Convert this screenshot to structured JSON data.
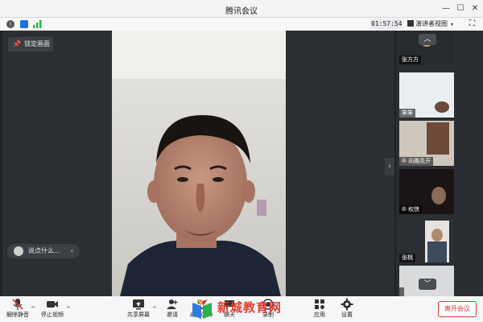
{
  "app": {
    "title": "腾讯会议"
  },
  "infobar": {
    "timer": "01:57:54",
    "view_label": "演讲者视图"
  },
  "stage": {
    "lock_label": "锁定画面",
    "chat_placeholder": "说点什么..."
  },
  "participants": [
    {
      "name": "张方方"
    },
    {
      "name": "笨笨"
    },
    {
      "name": "向晚花开"
    },
    {
      "name": "权侠"
    },
    {
      "name": "张桃"
    },
    {
      "name": ""
    }
  ],
  "toolbar": {
    "mute_label": "解除静音",
    "video_label": "停止视频",
    "share_label": "共享屏幕",
    "invite_label": "邀请",
    "members_label": "成员(17)",
    "chat_label": "聊天",
    "record_label": "录制",
    "apps_label": "应用",
    "settings_label": "设置",
    "leave_label": "离开会议"
  },
  "watermark": {
    "text": "新城教育网"
  },
  "colors": {
    "accent": "#1e6fe8",
    "leave": "#e0383a",
    "signal": "#2bb24c"
  }
}
